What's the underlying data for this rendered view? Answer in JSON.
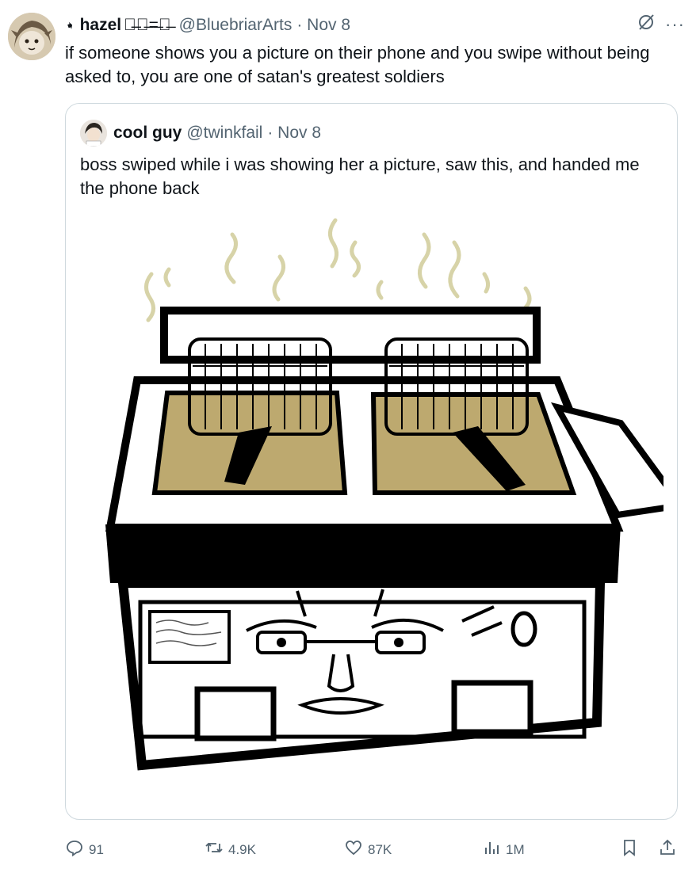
{
  "tweet": {
    "author_name": "hazel",
    "author_deco": "ー̶̶デ̶=̶一̶",
    "handle": "@BluebriarArts",
    "date": "· Nov 8",
    "text": "if someone shows you a picture on their phone and you swipe without being asked to, you are one of satan's greatest soldiers"
  },
  "quote": {
    "author_name": "cool guy",
    "handle": "@twinkfail",
    "date": "· Nov 8",
    "text": "boss swiped while i was showing her a picture, saw this, and handed me the phone back"
  },
  "actions": {
    "replies": "91",
    "reposts": "4.9K",
    "likes": "87K",
    "views": "1M"
  },
  "icons": {
    "pin": "pin-icon",
    "grok": "slashed-circle-icon",
    "more": "more-icon",
    "reply": "reply-icon",
    "repost": "repost-icon",
    "like": "heart-icon",
    "views": "views-icon",
    "bookmark": "bookmark-icon",
    "share": "share-icon"
  },
  "colors": {
    "muted": "#536471",
    "border": "#cfd9de",
    "oil": "#bda96f"
  }
}
